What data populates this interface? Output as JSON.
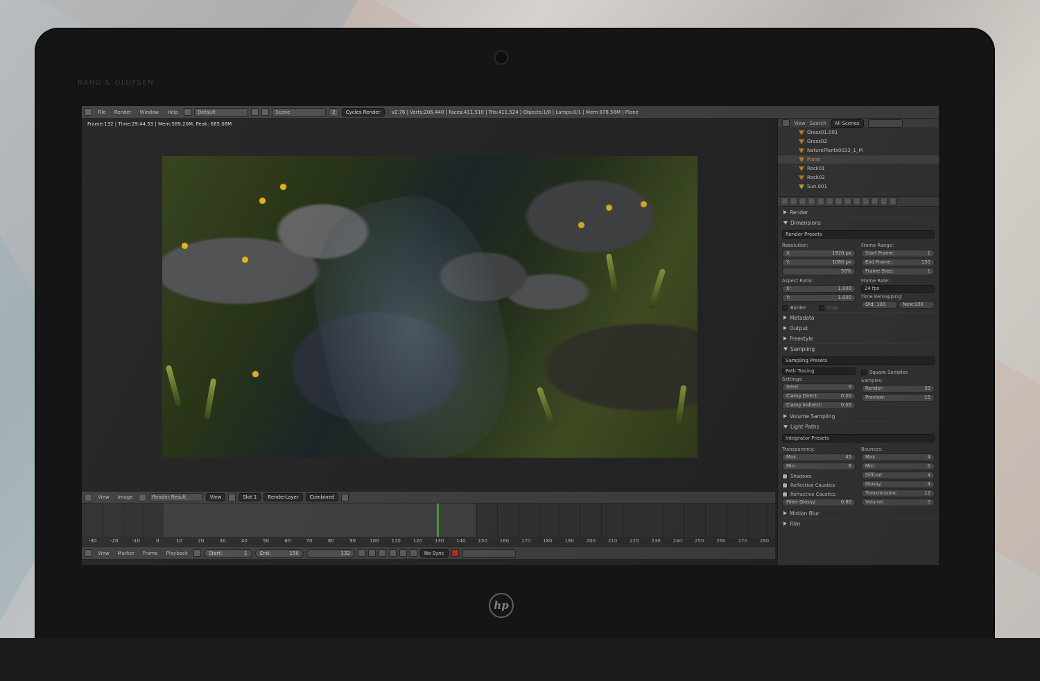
{
  "bezel": {
    "brand": "BANG & OLUFSEN",
    "logo": "hp"
  },
  "header": {
    "menus": [
      "File",
      "Render",
      "Window",
      "Help"
    ],
    "layout": "Default",
    "scene": "Scene",
    "scene_users": "2",
    "engine": "Cycles Render",
    "stats": "v2.76 | Verts:206,440 | Faces:411,510 | Tris:411,524 | Objects:1/8 | Lamps:0/1 | Mem:878.58M | Plane"
  },
  "viewport": {
    "frame_info": "Frame:132 | Time:29:44.53 | Mem:589.20M, Peak: 685.08M"
  },
  "image_editor": {
    "menus": [
      "View",
      "Image"
    ],
    "image": "Render Result",
    "view_label": "View",
    "slot": "Slot 1",
    "layer": "RenderLayer",
    "pass": "Combined"
  },
  "timeline": {
    "ticks": [
      "-30",
      "-20",
      "-10",
      "0",
      "10",
      "20",
      "30",
      "40",
      "50",
      "60",
      "70",
      "80",
      "90",
      "100",
      "110",
      "120",
      "130",
      "140",
      "150",
      "160",
      "170",
      "180",
      "190",
      "200",
      "210",
      "220",
      "230",
      "240",
      "250",
      "260",
      "270",
      "280"
    ],
    "menus": [
      "View",
      "Marker",
      "Frame",
      "Playback"
    ],
    "start_label": "Start:",
    "start_value": "1",
    "end_label": "End:",
    "end_value": "150",
    "current": "132",
    "sync": "No Sync"
  },
  "outliner": {
    "menus": [
      "View",
      "Search"
    ],
    "filter": "All Scenes",
    "items": [
      {
        "name": "Grass01.001"
      },
      {
        "name": "Grass02"
      },
      {
        "name": "NaturePlants0033_1_M"
      },
      {
        "name": "Plane"
      },
      {
        "name": "Rock01"
      },
      {
        "name": "Rock02"
      },
      {
        "name": "Sun.001"
      }
    ]
  },
  "properties": {
    "render": "Render",
    "dimensions": "Dimensions",
    "render_presets": "Render Presets",
    "resolution_label": "Resolution:",
    "res_x_label": "X:",
    "res_x": "1920 px",
    "res_y_label": "Y:",
    "res_y": "1080 px",
    "res_pct": "50%",
    "frame_range_label": "Frame Range:",
    "start_frame_label": "Start Frame:",
    "start_frame": "1",
    "end_frame_label": "End Frame:",
    "end_frame": "150",
    "frame_step_label": "Frame Step:",
    "frame_step": "1",
    "aspect_label": "Aspect Ratio:",
    "asp_x_label": "X:",
    "asp_x": "1.000",
    "asp_y_label": "Y:",
    "asp_y": "1.000",
    "frame_rate_label": "Frame Rate:",
    "fps": "24 fps",
    "time_remap_label": "Time Remapping:",
    "old": "Old: 100",
    "new": "New:100",
    "border": "Border",
    "crop": "Crop",
    "metadata": "Metadata",
    "output": "Output",
    "freestyle": "Freestyle",
    "sampling": "Sampling",
    "sampling_presets": "Sampling Presets",
    "path_tracing": "Path Tracing",
    "square_samples": "Square Samples",
    "settings_label": "Settings:",
    "seed_label": "Seed:",
    "seed": "0",
    "clamp_direct_label": "Clamp Direct:",
    "clamp_direct": "0.00",
    "clamp_indirect_label": "Clamp Indirect:",
    "clamp_indirect": "0.00",
    "samples_label": "Samples:",
    "render_samples_label": "Render:",
    "render_samples": "50",
    "preview_samples_label": "Preview:",
    "preview_samples": "15",
    "volume_sampling": "Volume Sampling",
    "light_paths": "Light Paths",
    "integrator_presets": "Integrator Presets",
    "transparency_label": "Transparency:",
    "t_max_label": "Max:",
    "t_max": "45",
    "t_min_label": "Min:",
    "t_min": "8",
    "shadows": "Shadows",
    "reflective_caustics": "Reflective Caustics",
    "refractive_caustics": "Refractive Caustics",
    "filter_glossy_label": "Filter Glossy:",
    "filter_glossy": "0.60",
    "bounces_label": "Bounces:",
    "b_max_label": "Max:",
    "b_max": "4",
    "b_min_label": "Min:",
    "b_min": "0",
    "diffuse_label": "Diffuse:",
    "diffuse": "4",
    "glossy_label": "Glossy:",
    "glossy": "4",
    "transmission_label": "Transmission:",
    "transmission": "12",
    "volume_label": "Volume:",
    "volume": "0",
    "motion_blur": "Motion Blur",
    "film": "Film"
  },
  "colors": {
    "accent": "#f4b040",
    "timeline_cursor": "#5fb32c",
    "panel": "#3d3d3d"
  }
}
